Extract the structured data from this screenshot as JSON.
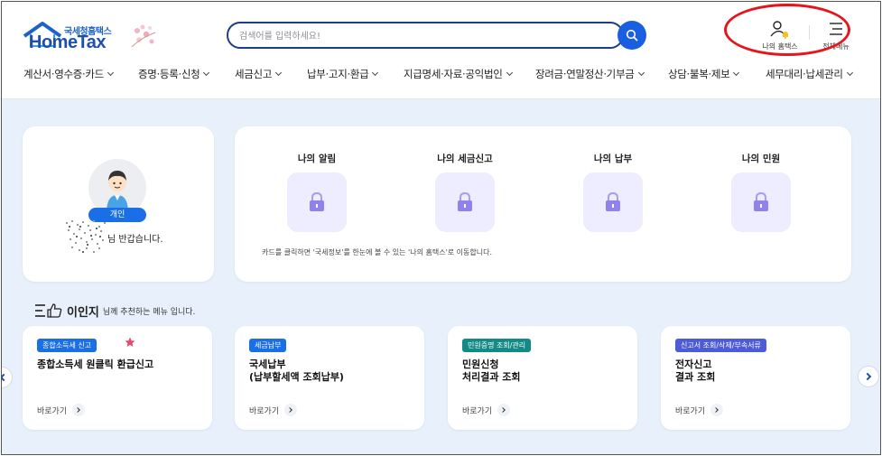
{
  "header": {
    "logo_small": "국세청홈택스",
    "logo_big": "HomeTax",
    "search_placeholder": "검색어를 입력하세요!",
    "my_hometax_label": "나의 홈택스",
    "full_menu_label": "전체메뉴"
  },
  "nav": {
    "items": [
      {
        "label": "계산서·영수증·카드"
      },
      {
        "label": "증명·등록·신청"
      },
      {
        "label": "세금신고"
      },
      {
        "label": "납부·고지·환급"
      },
      {
        "label": "지급명세·자료·공익법인"
      },
      {
        "label": "장려금·연말정산·기부금"
      },
      {
        "label": "상담·불복·제보"
      },
      {
        "label": "세무대리·납세관리"
      }
    ]
  },
  "profile": {
    "badge": "개인",
    "greeting": "님 반갑습니다."
  },
  "alerts": {
    "items": [
      {
        "title": "나의 알림"
      },
      {
        "title": "나의 세금신고"
      },
      {
        "title": "나의 납부"
      },
      {
        "title": "나의 민원"
      }
    ],
    "note": "카드를 클릭하면 '국세정보'를 한눈에 볼 수 있는 '나의 홈택스'로 이동합니다."
  },
  "recommend": {
    "name": "이인지",
    "rest": "님께 추천하는 메뉴 입니다.",
    "cards": [
      {
        "tag": "종합소득세 신고",
        "tag_color": "#1a6ee6",
        "title": "종합소득세 원클릭 환급신고",
        "link": "바로가기"
      },
      {
        "tag": "세금납부",
        "tag_color": "#1a6ee6",
        "title": "국세납부\n(납부할세액 조회납부)",
        "link": "바로가기"
      },
      {
        "tag": "민원증명 조회/관리",
        "tag_color": "#128a86",
        "title": "민원신청\n처리결과 조회",
        "link": "바로가기"
      },
      {
        "tag": "신고서 조회/삭제/부속서류",
        "tag_color": "#4c5bd6",
        "title": "전자신고\n결과 조회",
        "link": "바로가기"
      }
    ]
  },
  "colors": {
    "brand": "#1d4fae",
    "search_btn": "#1a5fe0",
    "main_bg": "#e8f1fb",
    "lock_bg": "#eeecff",
    "highlight_circle": "#e8141d"
  }
}
